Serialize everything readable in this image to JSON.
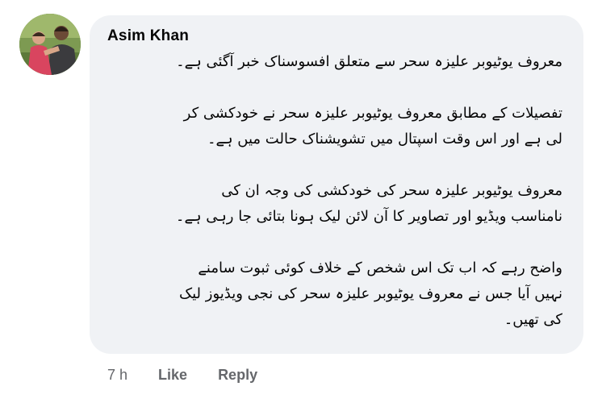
{
  "comment": {
    "author": "Asim Khan",
    "paragraphs": [
      [
        "معروف یوٹیوبر علیزہ سحر سے متعلق افسوسناک خبر آگئی ہے۔"
      ],
      [
        "تفصیلات کے مطابق معروف یوٹیوبر علیزہ سحر نے خودکشی کر",
        "لی ہے اور اس وقت اسپتال میں تشویشناک حالت میں ہے۔"
      ],
      [
        "معروف یوٹیوبر علیزہ سحر کی خودکشی کی وجہ ان کی",
        "نامناسب ویڈیو اور تصاویر کا آن لائن لیک ہونا بتائی جا رہی ہے۔"
      ],
      [
        "واضح رہے کہ اب تک اس شخص کے خلاف کوئی ثبوت سامنے",
        "نہیں آیا جس نے معروف یوٹیوبر علیزہ سحر کی نجی ویڈیوز لیک",
        "کی تھیں۔"
      ]
    ],
    "timestamp": "7 h",
    "like_label": "Like",
    "reply_label": "Reply"
  }
}
